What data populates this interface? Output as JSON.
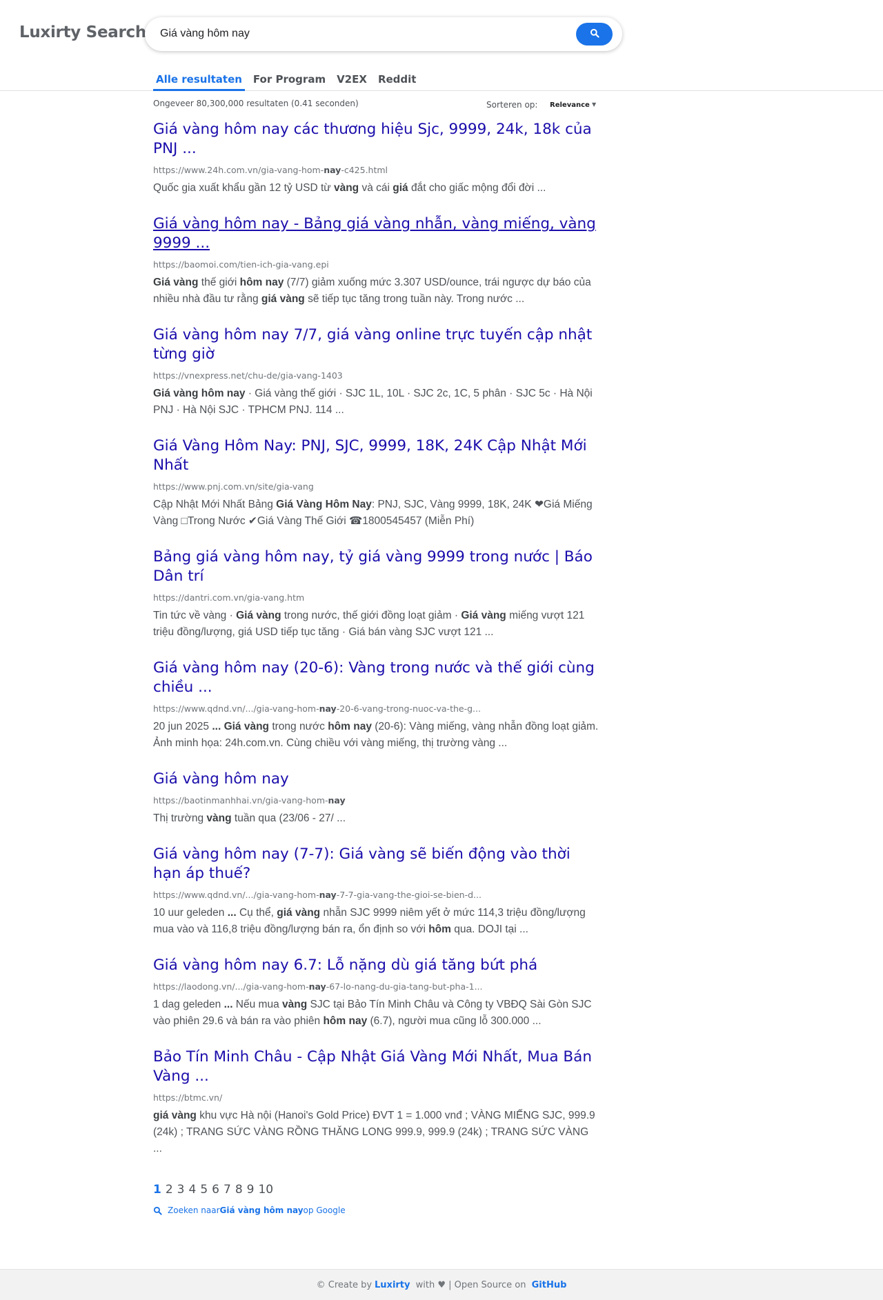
{
  "header": {
    "logo": "Luxirty Search",
    "search": {
      "value": "Giá vàng hôm nay",
      "placeholder": ""
    },
    "search_icon": "search-icon",
    "tabs": [
      {
        "label": "Alle resultaten",
        "active": true
      },
      {
        "label": "For Program",
        "active": false
      },
      {
        "label": "V2EX",
        "active": false
      },
      {
        "label": "Reddit",
        "active": false
      }
    ]
  },
  "stats": {
    "count_text": "Ongeveer 80,300,000 resultaten (0.41 seconden)",
    "sort_label": "Sorteren op:",
    "sort_value": "Relevance"
  },
  "results": [
    {
      "title": "Giá vàng hôm nay các thương hiệu Sjc, 9999, 24k, 18k của PNJ ...",
      "url_pre": "https://www.24h.com.vn/gia-vang-hom-",
      "url_bold": "nay",
      "url_post": "-c425.html",
      "snippet": [
        {
          "t": "Quốc gia xuất khẩu gần 12 tỷ USD từ ",
          "b": false
        },
        {
          "t": "vàng",
          "b": true
        },
        {
          "t": " và cái ",
          "b": false
        },
        {
          "t": "giá",
          "b": true
        },
        {
          "t": " đắt cho giấc mộng đổi đời ...",
          "b": false
        }
      ]
    },
    {
      "title": "Giá vàng hôm nay - Bảng giá vàng nhẫn, vàng miếng, vàng 9999 ...",
      "underline": true,
      "url_pre": "https://baomoi.com/tien-ich-gia-vang.epi",
      "url_bold": "",
      "url_post": "",
      "snippet": [
        {
          "t": "Giá vàng",
          "b": true
        },
        {
          "t": " thế giới ",
          "b": false
        },
        {
          "t": "hôm nay",
          "b": true
        },
        {
          "t": " (7/7) giảm xuống mức 3.307 USD/ounce, trái ngược dự báo của nhiều nhà đầu tư rằng ",
          "b": false
        },
        {
          "t": "giá vàng",
          "b": true
        },
        {
          "t": " sẽ tiếp tục tăng trong tuần này. Trong nước ...",
          "b": false
        }
      ]
    },
    {
      "title": "Giá vàng hôm nay 7/7, giá vàng online trực tuyến cập nhật từng giờ",
      "url_pre": "https://vnexpress.net/chu-de/gia-vang-1403",
      "url_bold": "",
      "url_post": "",
      "snippet": [
        {
          "t": "Giá vàng hôm nay",
          "b": true
        },
        {
          "t": " · Giá vàng thế giới · SJC 1L, 10L · SJC 2c, 1C, 5 phân · SJC 5c · Hà Nội PNJ · Hà Nội SJC · TPHCM PNJ. 114 ...",
          "b": false
        }
      ]
    },
    {
      "title": "Giá Vàng Hôm Nay: PNJ, SJC, 9999, 18K, 24K Cập Nhật Mới Nhất",
      "url_pre": "https://www.pnj.com.vn/site/gia-vang",
      "url_bold": "",
      "url_post": "",
      "snippet": [
        {
          "t": "Cập Nhật Mới Nhất Bảng ",
          "b": false
        },
        {
          "t": "Giá Vàng Hôm Nay",
          "b": true
        },
        {
          "t": ": PNJ, SJC, Vàng 9999, 18K, 24K ❤Giá Miếng Vàng □Trong Nước ✔Giá Vàng Thế Giới ☎1800545457 (Miễn Phí)",
          "b": false
        }
      ]
    },
    {
      "title": "Bảng giá vàng hôm nay, tỷ giá vàng 9999 trong nước | Báo Dân trí",
      "url_pre": "https://dantri.com.vn/gia-vang.htm",
      "url_bold": "",
      "url_post": "",
      "snippet": [
        {
          "t": "Tin tức về vàng · ",
          "b": false
        },
        {
          "t": "Giá vàng",
          "b": true
        },
        {
          "t": " trong nước, thế giới đồng loạt giảm · ",
          "b": false
        },
        {
          "t": "Giá vàng",
          "b": true
        },
        {
          "t": " miếng vượt 121 triệu đồng/lượng, giá USD tiếp tục tăng · Giá bán vàng SJC vượt 121 ...",
          "b": false
        }
      ]
    },
    {
      "title": "Giá vàng hôm nay (20-6): Vàng trong nước và thế giới cùng chiều ...",
      "url_pre": "https://www.qdnd.vn/.../gia-vang-hom-",
      "url_bold": "nay",
      "url_post": "-20-6-vang-trong-nuoc-va-the-g...",
      "snippet": [
        {
          "t": "20 jun 2025 ",
          "b": false
        },
        {
          "t": "...",
          "b": true
        },
        {
          "t": " ",
          "b": false
        },
        {
          "t": "Giá vàng",
          "b": true
        },
        {
          "t": " trong nước ",
          "b": false
        },
        {
          "t": "hôm nay",
          "b": true
        },
        {
          "t": " (20-6): Vàng miếng, vàng nhẫn đồng loạt giảm. Ảnh minh họa: 24h.com.vn. Cùng chiều với vàng miếng, thị trường vàng ...",
          "b": false
        }
      ]
    },
    {
      "title": "Giá vàng hôm nay",
      "url_pre": "https://baotinmanhhai.vn/gia-vang-hom-",
      "url_bold": "nay",
      "url_post": "",
      "snippet": [
        {
          "t": "Thị trường ",
          "b": false
        },
        {
          "t": "vàng",
          "b": true
        },
        {
          "t": " tuần qua (23/06 - 27/ ...",
          "b": false
        }
      ]
    },
    {
      "title": "Giá vàng hôm nay (7-7): Giá vàng sẽ biến động vào thời hạn áp thuế?",
      "url_pre": "https://www.qdnd.vn/.../gia-vang-hom-",
      "url_bold": "nay",
      "url_post": "-7-7-gia-vang-the-gioi-se-bien-d...",
      "snippet": [
        {
          "t": "10 uur geleden ",
          "b": false
        },
        {
          "t": "...",
          "b": true
        },
        {
          "t": " Cụ thể, ",
          "b": false
        },
        {
          "t": "giá vàng",
          "b": true
        },
        {
          "t": " nhẫn SJC 9999 niêm yết ở mức 114,3 triệu đồng/lượng mua vào và 116,8 triệu đồng/lượng bán ra, ổn định so với ",
          "b": false
        },
        {
          "t": "hôm",
          "b": true
        },
        {
          "t": " qua. DOJI tại ...",
          "b": false
        }
      ]
    },
    {
      "title": "Giá vàng hôm nay 6.7: Lỗ nặng dù giá tăng bứt phá",
      "url_pre": "https://laodong.vn/.../gia-vang-hom-",
      "url_bold": "nay",
      "url_post": "-67-lo-nang-du-gia-tang-but-pha-1...",
      "snippet": [
        {
          "t": "1 dag geleden ",
          "b": false
        },
        {
          "t": "...",
          "b": true
        },
        {
          "t": " Nếu mua ",
          "b": false
        },
        {
          "t": "vàng",
          "b": true
        },
        {
          "t": " SJC tại Bảo Tín Minh Châu và Công ty VBĐQ Sài Gòn SJC vào phiên 29.6 và bán ra vào phiên ",
          "b": false
        },
        {
          "t": "hôm nay",
          "b": true
        },
        {
          "t": " (6.7), người mua cũng lỗ 300.000 ...",
          "b": false
        }
      ]
    },
    {
      "title": "Bảo Tín Minh Châu - Cập Nhật Giá Vàng Mới Nhất, Mua Bán Vàng ...",
      "url_pre": "https://btmc.vn/",
      "url_bold": "",
      "url_post": "",
      "snippet": [
        {
          "t": "giá vàng",
          "b": true
        },
        {
          "t": " khu vực Hà nội (Hanoi's Gold Price) ĐVT 1 = 1.000 vnđ ; VÀNG MIẾNG SJC, 999.9 (24k) ; TRANG SỨC VÀNG RỒNG THĂNG LONG 999.9, 999.9 (24k) ; TRANG SỨC VÀNG ...",
          "b": false
        }
      ]
    }
  ],
  "pagination": {
    "pages": [
      "1",
      "2",
      "3",
      "4",
      "5",
      "6",
      "7",
      "8",
      "9",
      "10"
    ],
    "current": "1"
  },
  "google_search": {
    "prefix": "Zoeken naar ",
    "query": "Giá vàng hôm nay",
    "suffix": " op Google"
  },
  "footer": {
    "prefix": "© Create by ",
    "brand": "Luxirty",
    "middle": " with ♥ | Open Source on ",
    "github": "GitHub"
  },
  "colors": {
    "accent": "#1a73e8",
    "title_link": "#1a0dab"
  }
}
